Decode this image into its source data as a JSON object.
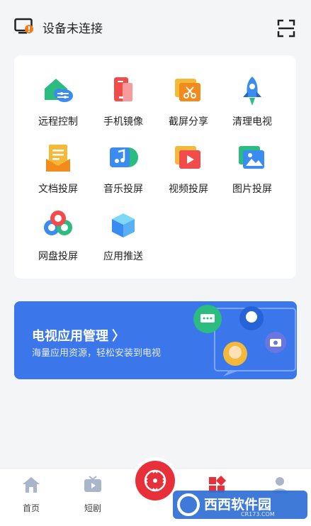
{
  "header": {
    "device_status": "设备未连接",
    "tv_icon": "tv-warning-icon",
    "scan_icon": "scan-icon"
  },
  "features": [
    {
      "label": "远程控制",
      "icon": "remote-control-icon"
    },
    {
      "label": "手机镜像",
      "icon": "phone-mirror-icon"
    },
    {
      "label": "截屏分享",
      "icon": "screenshot-share-icon"
    },
    {
      "label": "清理电视",
      "icon": "rocket-icon"
    },
    {
      "label": "文档投屏",
      "icon": "document-icon"
    },
    {
      "label": "音乐投屏",
      "icon": "music-icon"
    },
    {
      "label": "视频投屏",
      "icon": "video-icon"
    },
    {
      "label": "图片投屏",
      "icon": "image-icon"
    },
    {
      "label": "网盘投屏",
      "icon": "cloud-disk-icon"
    },
    {
      "label": "应用推送",
      "icon": "cube-icon"
    }
  ],
  "banner": {
    "title": "电视应用管理 〉",
    "subtitle": "海量应用资源，轻松安装到电视"
  },
  "tabbar": {
    "items": [
      {
        "label": "首页",
        "icon": "home-icon"
      },
      {
        "label": "短剧",
        "icon": "tv-play-icon"
      },
      {
        "label": "",
        "icon": "remote-dpad-icon"
      },
      {
        "label": "",
        "icon": "apps-icon"
      },
      {
        "label": "",
        "icon": "user-icon"
      }
    ]
  },
  "watermark": {
    "text": "西西软件园",
    "domain": "CR173.COM"
  },
  "colors": {
    "accent": "#3b76ea",
    "red": "#e8303a",
    "orange": "#f39c12"
  }
}
